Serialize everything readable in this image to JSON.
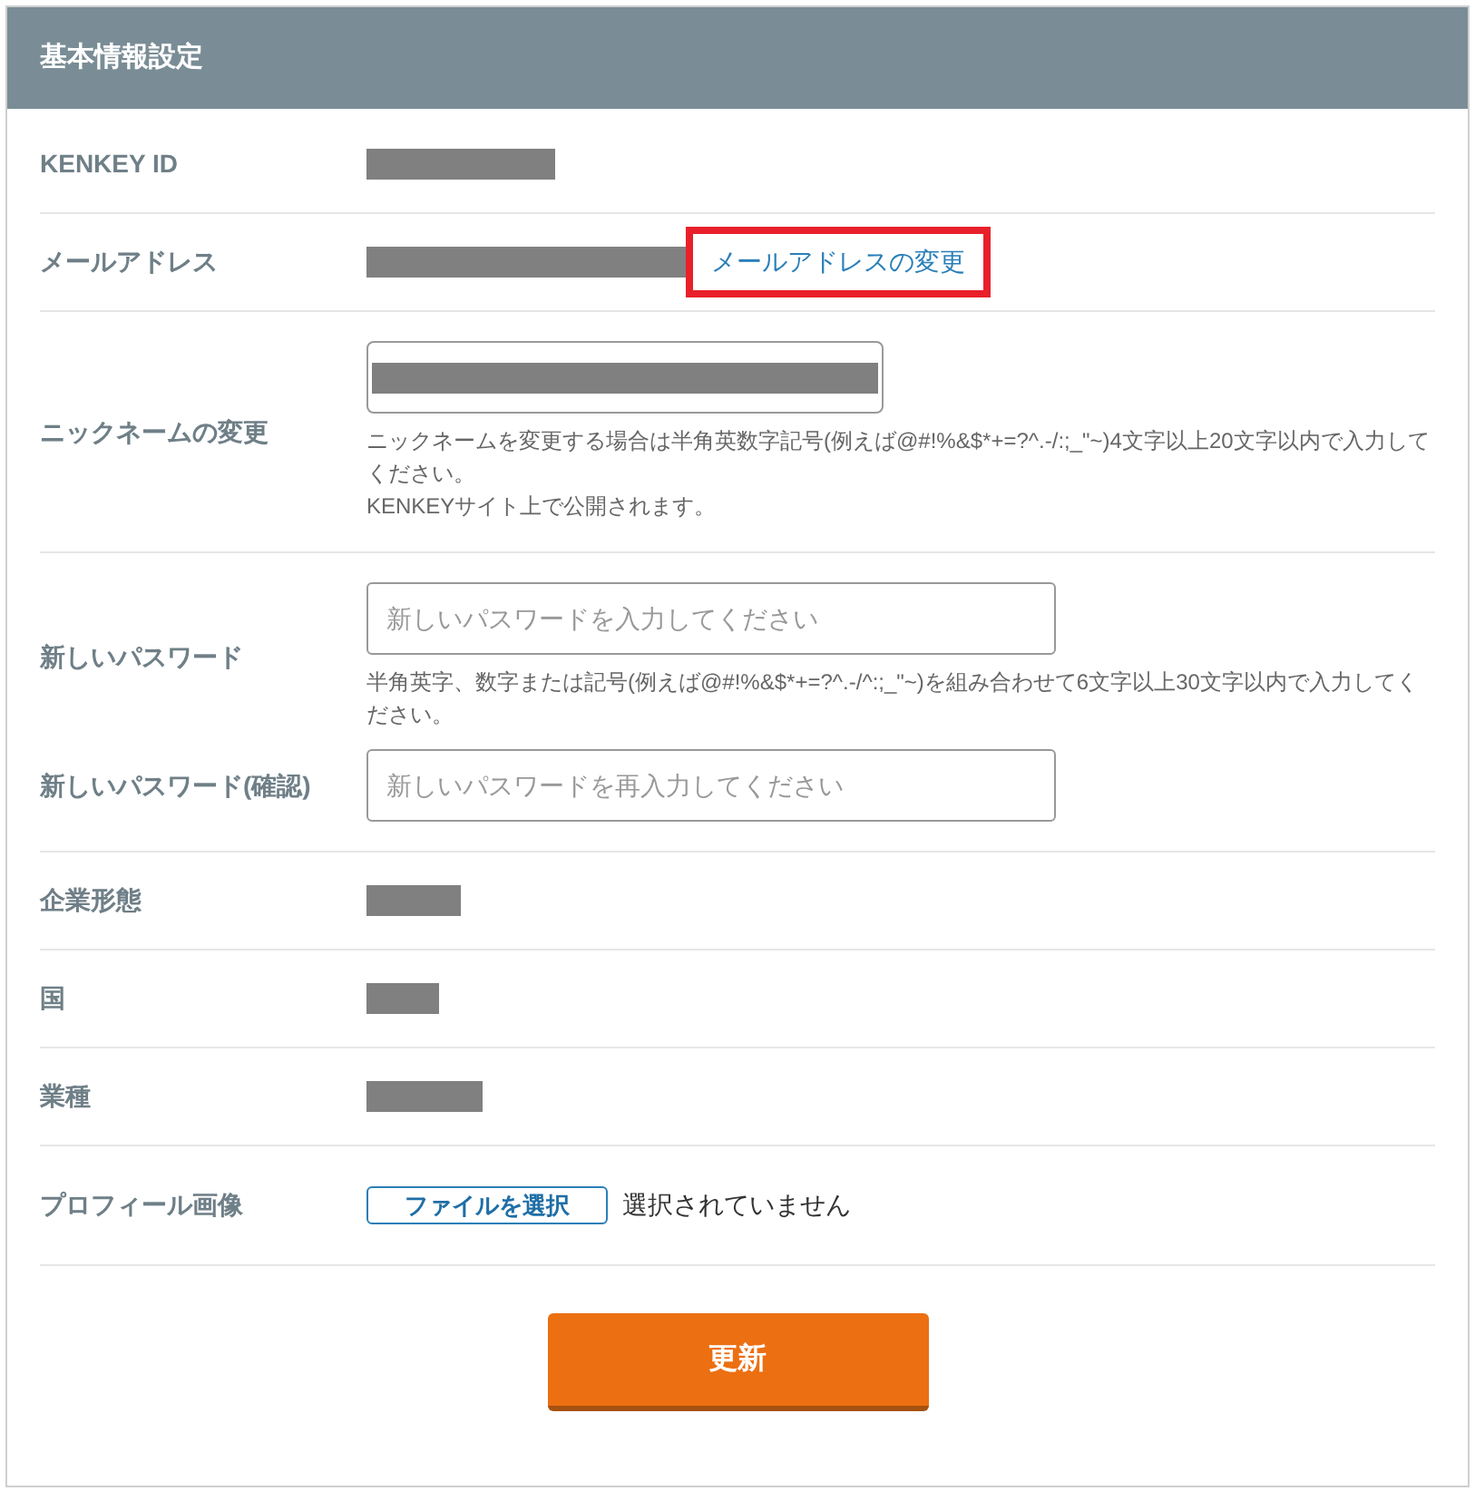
{
  "header": {
    "title": "基本情報設定"
  },
  "rows": [
    {
      "kind": "static",
      "label": "KENKEY ID"
    },
    {
      "kind": "email",
      "label": "メールアドレス",
      "link": "メールアドレスの変更",
      "highlighted": true
    },
    {
      "kind": "nickname",
      "label": "ニックネームの変更",
      "help": [
        "ニックネームを変更する場合は半角英数字記号(例えば@#!%&$*+=?^.-/:;_\"~)4文字以上20文字以内で入力してください。",
        "KENKEYサイト上で公開されます。"
      ]
    },
    {
      "kind": "password",
      "label": "新しいパスワード",
      "placeholder": "新しいパスワードを入力してください",
      "help": "半角英字、数字または記号(例えば@#!%&$*+=?^.-/^:;_\"~)を組み合わせて6文字以上30文字以内で入力してください。",
      "confirm_label": "新しいパスワード(確認)",
      "confirm_placeholder": "新しいパスワードを再入力してください"
    },
    {
      "kind": "static",
      "label": "企業形態"
    },
    {
      "kind": "static",
      "label": "国"
    },
    {
      "kind": "static",
      "label": "業種"
    },
    {
      "kind": "file",
      "label": "プロフィール画像",
      "button": "ファイルを選択",
      "status": "選択されていません"
    }
  ],
  "submit": "更新"
}
